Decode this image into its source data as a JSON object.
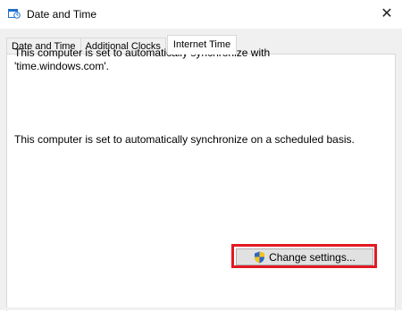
{
  "window": {
    "title": "Date and Time",
    "close_glyph": "✕"
  },
  "tabs": [
    {
      "label": "Date and Time"
    },
    {
      "label": "Additional Clocks"
    },
    {
      "label": "Internet Time"
    }
  ],
  "active_tab": "Internet Time",
  "content": {
    "sync_line1": "This computer is set to automatically synchronize with",
    "sync_line2": "'time.windows.com'.",
    "schedule_text": "This computer is set to automatically synchronize on a scheduled basis."
  },
  "buttons": {
    "change_settings": "Change settings..."
  },
  "colors": {
    "highlight": "#e21922",
    "shield_blue": "#2b67c9",
    "shield_yellow": "#f5c518"
  },
  "icons": {
    "app": "date-time-app-icon",
    "close": "close-icon",
    "uac": "uac-shield-icon"
  }
}
